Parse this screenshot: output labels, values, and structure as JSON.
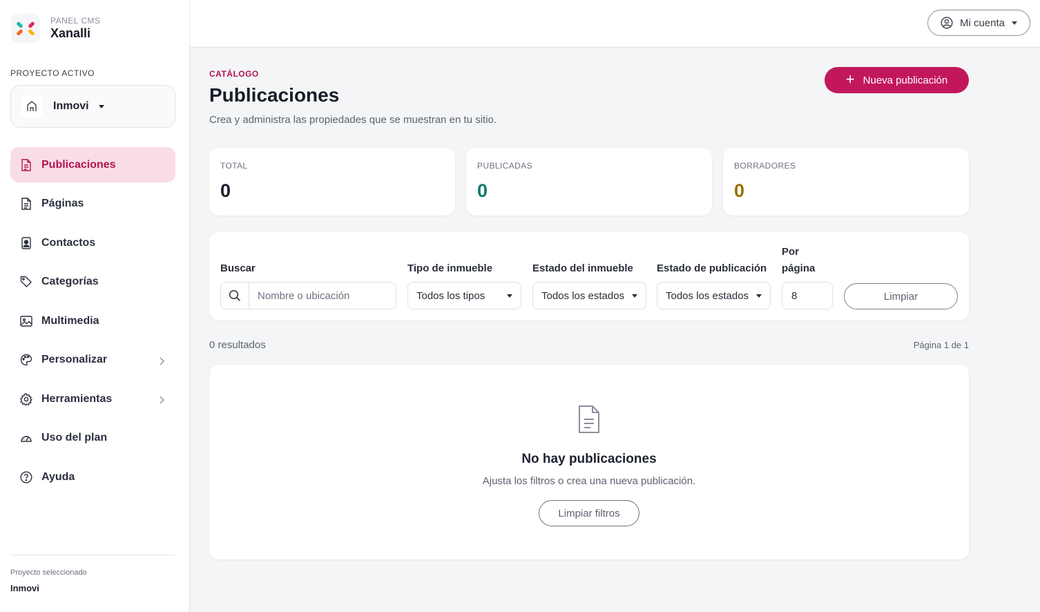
{
  "brand": {
    "subtitle": "PANEL CMS",
    "name": "Xanalli",
    "logo_icon": "xanalli-logo"
  },
  "sidebar": {
    "project_label": "PROYECTO ACTIVO",
    "project_name": "Inmovi",
    "items": [
      {
        "label": "Publicaciones",
        "icon": "document-icon",
        "active": true
      },
      {
        "label": "Páginas",
        "icon": "file-text-icon"
      },
      {
        "label": "Contactos",
        "icon": "contact-icon"
      },
      {
        "label": "Categorías",
        "icon": "tags-icon"
      },
      {
        "label": "Multimedia",
        "icon": "images-icon"
      },
      {
        "label": "Personalizar",
        "icon": "palette-icon",
        "has_submenu": true
      },
      {
        "label": "Herramientas",
        "icon": "gear-icon",
        "has_submenu": true
      },
      {
        "label": "Uso del plan",
        "icon": "speedometer-icon"
      },
      {
        "label": "Ayuda",
        "icon": "question-circle-icon"
      }
    ],
    "footer": {
      "label": "Proyecto seleccionado",
      "value": "Inmovi"
    }
  },
  "topbar": {
    "account_label": "Mi cuenta"
  },
  "header": {
    "eyebrow": "CATÁLOGO",
    "title": "Publicaciones",
    "description": "Crea y administra las propiedades que se muestran en tu sitio.",
    "new_button": "Nueva publicación"
  },
  "stats": [
    {
      "label": "TOTAL",
      "value": "0",
      "color": "#1a1d29"
    },
    {
      "label": "PUBLICADAS",
      "value": "0",
      "color": "#0f7a6a"
    },
    {
      "label": "BORRADORES",
      "value": "0",
      "color": "#9a7000"
    }
  ],
  "filters": {
    "search_label": "Buscar",
    "search_placeholder": "Nombre o ubicación",
    "type_label": "Tipo de inmueble",
    "type_value": "Todos los tipos",
    "property_state_label": "Estado del inmueble",
    "property_state_value": "Todos los estados",
    "publish_state_label": "Estado de publicación",
    "publish_state_value": "Todos los estados",
    "per_page_label_1": "Por",
    "per_page_label_2": "página",
    "per_page_value": "8",
    "clear_label": "Limpiar"
  },
  "results": {
    "count": "0 resultados",
    "page": "Página 1 de 1"
  },
  "empty": {
    "icon": "document-icon",
    "title": "No hay publicaciones",
    "description": "Ajusta los filtros o crea una nueva publicación.",
    "button": "Limpiar filtros"
  },
  "colors": {
    "accent": "#c2185b",
    "active_bg": "#f8dde6"
  }
}
